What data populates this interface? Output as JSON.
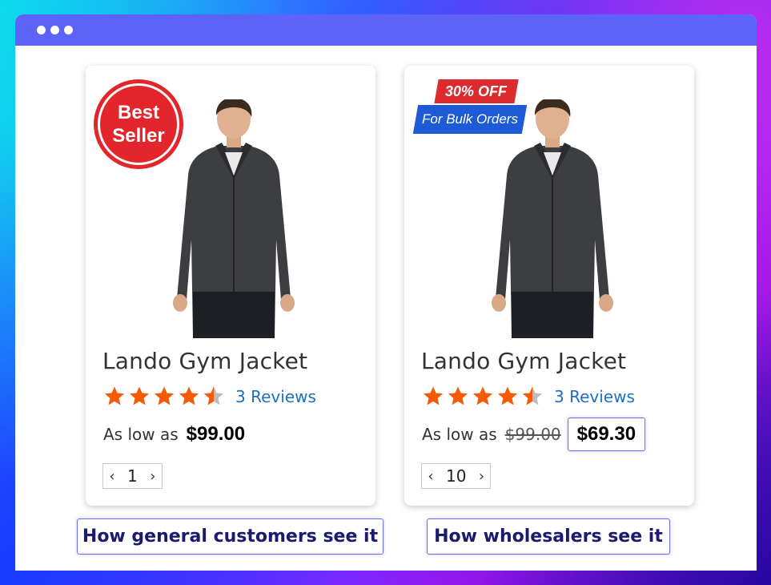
{
  "window": {
    "dots": 3
  },
  "colors": {
    "titlebar": "#5d63f6",
    "star": "#f55a05",
    "star_empty": "#bdbdbd",
    "link": "#1f6fc0",
    "badge_red": "#e3262c",
    "badge_blue": "#1d5bd6",
    "caption_border": "#6b6ff2"
  },
  "cards": {
    "general": {
      "badge": "Best Seller",
      "name": "Lando Gym Jacket",
      "rating": 3.5,
      "reviews": "3 Reviews",
      "price_prefix": "As low as",
      "price": "$99.00",
      "quantity": "1",
      "image_icon": "jacket-photo-icon"
    },
    "wholesale": {
      "promo_top": "30% OFF",
      "promo_bottom": "For Bulk Orders",
      "name": "Lando Gym Jacket",
      "rating": 3.5,
      "reviews": "3 Reviews",
      "price_prefix": "As low as",
      "old_price": "$99.00",
      "price": "$69.30",
      "quantity": "10",
      "image_icon": "jacket-photo-icon"
    }
  },
  "captions": {
    "general": "How general customers see it",
    "wholesale": "How wholesalers see it"
  }
}
